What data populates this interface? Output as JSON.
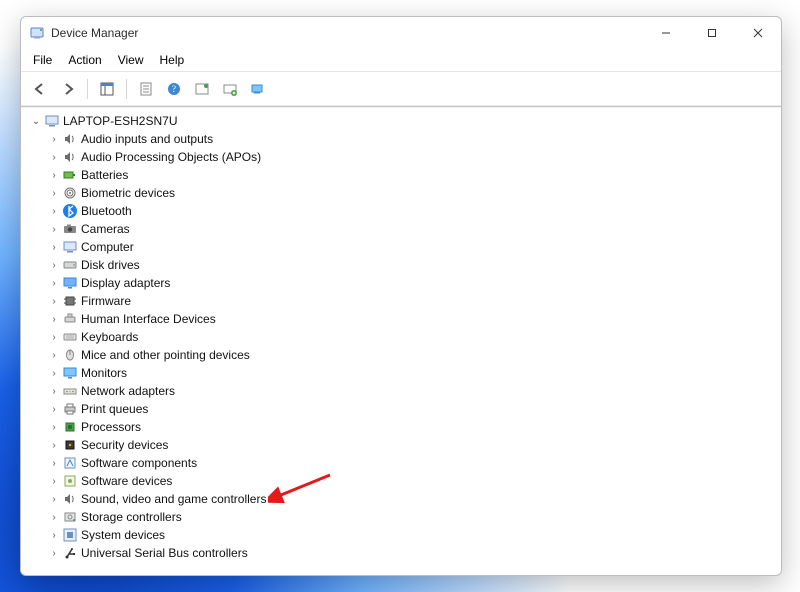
{
  "window": {
    "title": "Device Manager"
  },
  "menubar": {
    "items": [
      {
        "label": "File"
      },
      {
        "label": "Action"
      },
      {
        "label": "View"
      },
      {
        "label": "Help"
      }
    ]
  },
  "toolbar": {
    "buttons": [
      {
        "id": "back",
        "label": "Back"
      },
      {
        "id": "forward",
        "label": "Forward"
      },
      {
        "id": "show-hide-tree",
        "label": "Show/Hide Console Tree"
      },
      {
        "id": "properties",
        "label": "Properties"
      },
      {
        "id": "help",
        "label": "Help"
      },
      {
        "id": "update-driver",
        "label": "Update Driver"
      },
      {
        "id": "add-hardware",
        "label": "Add legacy hardware"
      },
      {
        "id": "scan-hardware",
        "label": "Scan for hardware changes"
      }
    ]
  },
  "tree": {
    "root": {
      "label": "LAPTOP-ESH2SN7U",
      "expanded": true
    },
    "categories": [
      {
        "label": "Audio inputs and outputs",
        "icon": "speaker"
      },
      {
        "label": "Audio Processing Objects (APOs)",
        "icon": "speaker"
      },
      {
        "label": "Batteries",
        "icon": "battery"
      },
      {
        "label": "Biometric devices",
        "icon": "fingerprint"
      },
      {
        "label": "Bluetooth",
        "icon": "bluetooth"
      },
      {
        "label": "Cameras",
        "icon": "camera"
      },
      {
        "label": "Computer",
        "icon": "computer"
      },
      {
        "label": "Disk drives",
        "icon": "disk"
      },
      {
        "label": "Display adapters",
        "icon": "display"
      },
      {
        "label": "Firmware",
        "icon": "chip"
      },
      {
        "label": "Human Interface Devices",
        "icon": "hid"
      },
      {
        "label": "Keyboards",
        "icon": "keyboard"
      },
      {
        "label": "Mice and other pointing devices",
        "icon": "mouse"
      },
      {
        "label": "Monitors",
        "icon": "monitor"
      },
      {
        "label": "Network adapters",
        "icon": "network"
      },
      {
        "label": "Print queues",
        "icon": "printer"
      },
      {
        "label": "Processors",
        "icon": "cpu"
      },
      {
        "label": "Security devices",
        "icon": "security"
      },
      {
        "label": "Software components",
        "icon": "softcomp"
      },
      {
        "label": "Software devices",
        "icon": "softdev"
      },
      {
        "label": "Sound, video and game controllers",
        "icon": "speaker"
      },
      {
        "label": "Storage controllers",
        "icon": "storage"
      },
      {
        "label": "System devices",
        "icon": "system"
      },
      {
        "label": "Universal Serial Bus controllers",
        "icon": "usb"
      }
    ]
  },
  "annotation": {
    "target_label": "Sound, video and game controllers",
    "color": "#e21b1b"
  }
}
